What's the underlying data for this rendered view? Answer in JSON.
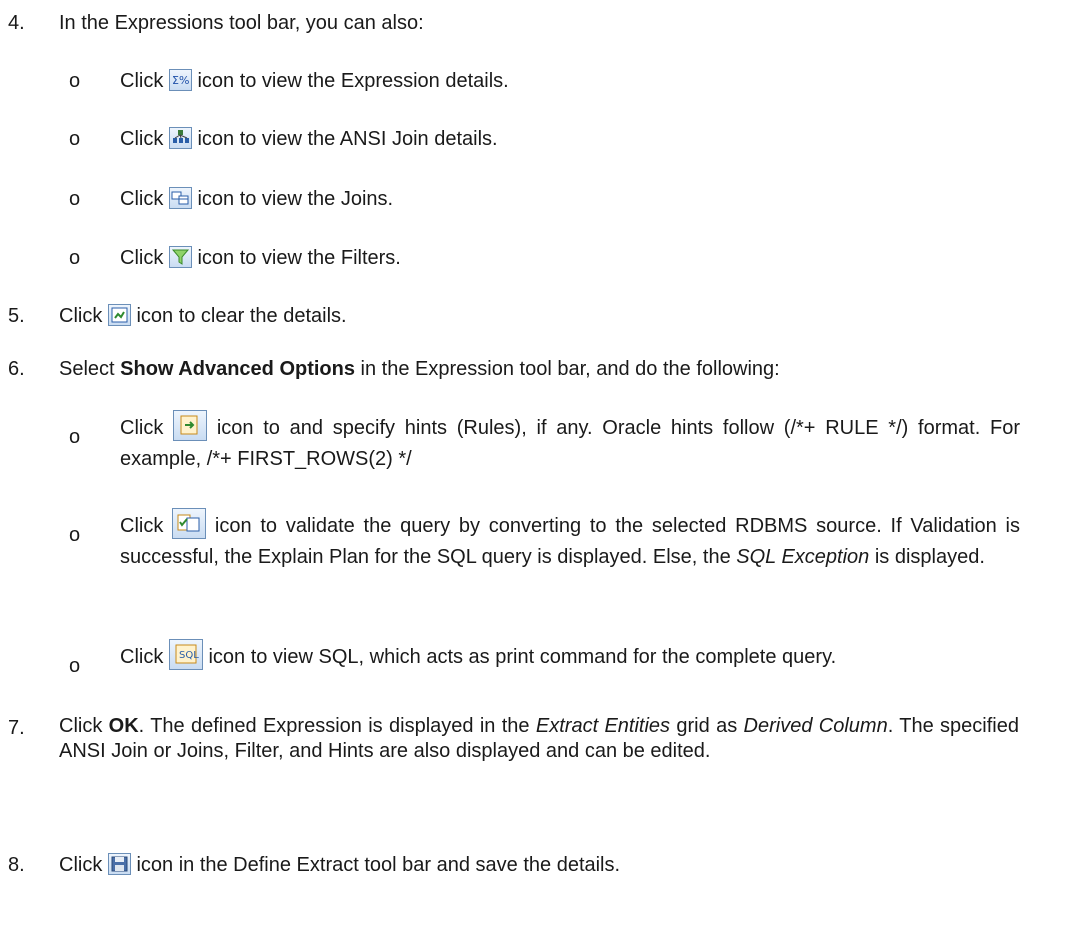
{
  "steps": {
    "s4": {
      "num": "4.",
      "text": "In the Expressions tool bar, you can also:"
    },
    "s4_items": [
      {
        "pre": "Click ",
        "post": " icon to view the Expression details.",
        "icon": "expression-sigma-icon"
      },
      {
        "pre": "Click ",
        "post": " icon to view the ANSI Join details.",
        "icon": "ansi-join-icon"
      },
      {
        "pre": "Click ",
        "post": " icon to view the Joins.",
        "icon": "joins-icon"
      },
      {
        "pre": "Click ",
        "post": " icon to view the Filters.",
        "icon": "filter-funnel-icon"
      }
    ],
    "s5": {
      "num": "5.",
      "pre": "Click ",
      "post": " icon to clear the details.",
      "icon": "clear-icon"
    },
    "s6": {
      "num": "6.",
      "pre": "Select ",
      "bold": "Show Advanced Options",
      "post": " in the Expression tool bar, and do the following:"
    },
    "s6_items": [
      {
        "pre": "Click ",
        "post": " icon to and specify hints (Rules), if any. Oracle hints follow (/*+ RULE */) format. For example, /*+ FIRST_ROWS(2) */",
        "icon": "hints-icon"
      },
      {
        "pre": "Click ",
        "mid": " icon to validate the query by converting to the selected RDBMS source. If Validation is successful, the Explain Plan for the SQL query is displayed. Else, the ",
        "ital": "SQL Exception",
        "post": " is displayed.",
        "icon": "validate-icon"
      },
      {
        "pre": "Click ",
        "post": " icon to view SQL, which acts as print command for the complete query.",
        "icon": "view-sql-icon"
      }
    ],
    "s7": {
      "num": "7.",
      "pre": "Click ",
      "bold": "OK",
      "a": ". The defined Expression is displayed in the ",
      "ital1": "Extract Entities",
      "b": " grid as ",
      "ital2": "Derived Column",
      "c": ". The specified ANSI Join or Joins, Filter, and Hints are also displayed and can be edited."
    },
    "s8": {
      "num": "8.",
      "pre": "Click ",
      "post": " icon in the Define Extract tool bar and save the details.",
      "icon": "save-icon"
    }
  },
  "bullet_char": "o",
  "colors": {
    "text": "#1a1a1a",
    "icon_border": "#6b8fb8"
  }
}
